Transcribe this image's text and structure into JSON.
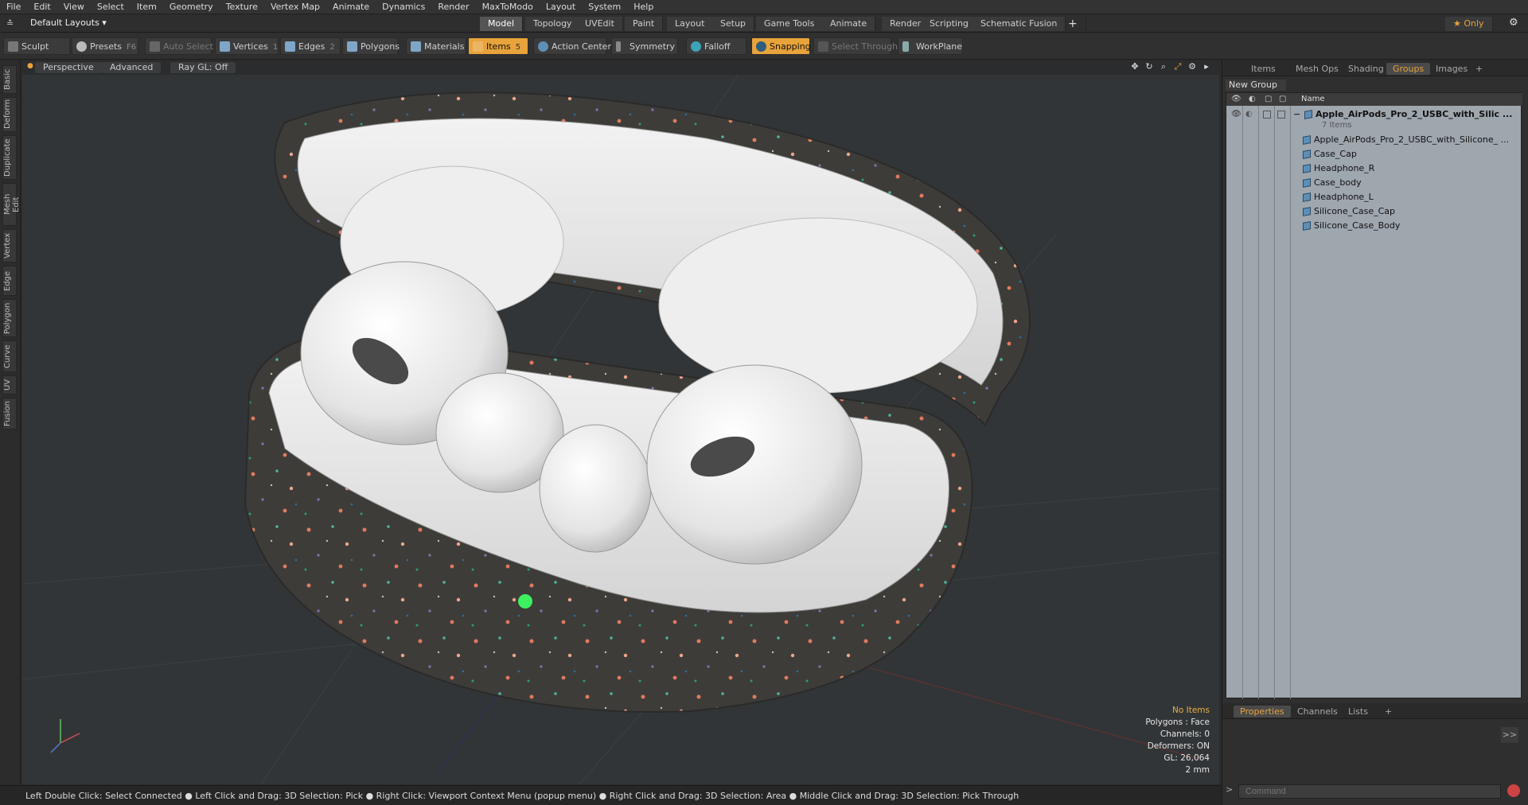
{
  "menubar": [
    "File",
    "Edit",
    "View",
    "Select",
    "Item",
    "Geometry",
    "Texture",
    "Vertex Map",
    "Animate",
    "Dynamics",
    "Render",
    "MaxToModo",
    "Layout",
    "System",
    "Help"
  ],
  "layout_dropdown": "Default Layouts ▾",
  "mode_tabs": [
    "Model",
    "Topology",
    "UVEdit",
    "Paint",
    "Layout",
    "Setup",
    "Game Tools",
    "Animate",
    "Render",
    "Scripting",
    "Schematic Fusion"
  ],
  "only_label": "★ Only",
  "toolbar": {
    "sculpt": "Sculpt",
    "presets": "Presets",
    "presets_key": "F6",
    "auto_select": "Auto Select",
    "vertices": "Vertices",
    "vertices_count": "1",
    "edges": "Edges",
    "edges_count": "2",
    "polygons": "Polygons",
    "materials": "Materials",
    "items": "Items",
    "items_count": "5",
    "action_center": "Action Center",
    "symmetry": "Symmetry",
    "falloff": "Falloff",
    "snapping": "Snapping",
    "select_through": "Select Through",
    "workplane": "WorkPlane"
  },
  "left_tabs": [
    "Basic",
    "Deform",
    "Duplicate",
    "Mesh Edit",
    "Vertex",
    "Edge",
    "Polygon",
    "Curve",
    "UV",
    "Fusion"
  ],
  "viewport": {
    "perspective": "Perspective",
    "advanced": "Advanced",
    "raygl": "Ray GL: Off"
  },
  "stats": {
    "no_items": "No Items",
    "polygons": "Polygons : Face",
    "channels": "Channels: 0",
    "deformers": "Deformers: ON",
    "gl": "GL: 26,064",
    "scale": "2 mm"
  },
  "statusbar": "Left Double Click: Select Connected ● Left Click and Drag: 3D Selection: Pick ● Right Click: Viewport Context Menu (popup menu) ● Right Click and Drag: 3D Selection: Area ● Middle Click and Drag: 3D Selection: Pick Through",
  "right_tabs_top": [
    "Items",
    "Mesh Ops",
    "Shading",
    "Groups",
    "Images",
    "+"
  ],
  "new_group": "New Group",
  "tree_header": "Name",
  "tree": {
    "group": "Apple_AirPods_Pro_2_USBC_with_Silic ...",
    "count": "7 Items",
    "items": [
      "Apple_AirPods_Pro_2_USBC_with_Silicone_ ...",
      "Case_Cap",
      "Headphone_R",
      "Case_body",
      "Headphone_L",
      "Silicone_Case_Cap",
      "Silicone_Case_Body"
    ]
  },
  "right_tabs_bottom": [
    "Properties",
    "Channels",
    "Lists",
    "+"
  ],
  "command_placeholder": "Command",
  "colors": {
    "accent": "#e8a33b",
    "tree_bg": "#9ea6ae"
  }
}
